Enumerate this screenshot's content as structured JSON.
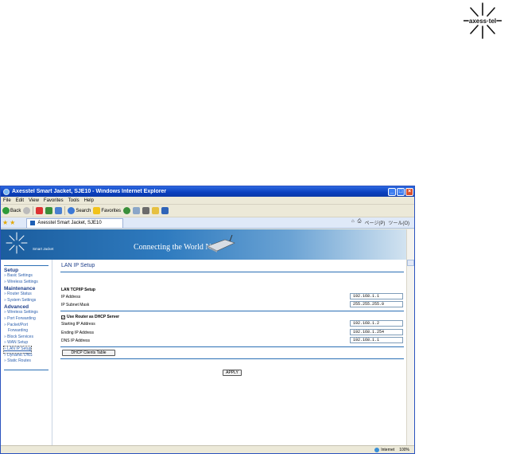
{
  "window": {
    "title": "Axesstel Smart Jacket, SJE10 - Windows Internet Explorer"
  },
  "menu": [
    "File",
    "Edit",
    "View",
    "Favorites",
    "Tools",
    "Help"
  ],
  "toolbar": {
    "back_label": "Back",
    "search_label": "Search",
    "favorites_label": "Favorites"
  },
  "tab": {
    "title": "Axesstel Smart Jacket, SJE10"
  },
  "command_bar": {
    "page_label": "ページ(P)",
    "tools_label": "ツール(O)"
  },
  "banner": {
    "product_label": "Smart Jacket",
    "slogan": "Connecting the World Now"
  },
  "sidebar": {
    "groups": [
      {
        "heading": "Setup",
        "items": [
          "Basic Settings",
          "Wireless Settings"
        ]
      },
      {
        "heading": "Maintenance",
        "items": [
          "Router Status",
          "System Settings"
        ]
      },
      {
        "heading": "Advanced",
        "items": [
          "Wireless Settings",
          "Port Forwarding",
          "Packet/Port",
          "Forwarding",
          "Block Services",
          "WAN Setup",
          "LAN IP Setup",
          "Dynamic DNS",
          "Static Routes"
        ]
      }
    ]
  },
  "main": {
    "title": "LAN IP Setup",
    "tcpip_section": "LAN TCP/IP Setup",
    "ip_address_label": "IP Address",
    "ip_address_value": "192.168.1.1",
    "subnet_label": "IP Subnet Mask",
    "subnet_value": "255.255.255.0",
    "dhcp_checkbox_label": "Use Router as DHCP Server",
    "start_ip_label": "Starting IP Address",
    "start_ip_value": "192.168.1.2",
    "end_ip_label": "Ending IP Address",
    "end_ip_value": "192.168.1.254",
    "dns_label": "DNS IP Address",
    "dns_value": "192.168.1.1",
    "dhcp_table_button": "DHCP Clients Table",
    "apply_button": "APPLY"
  },
  "status": {
    "zone": "Internet",
    "zoom": "100%"
  },
  "colors": {
    "accent": "#2b6fb5",
    "heading": "#1e3f8a",
    "link": "#2b5fad",
    "titlebar": "#0a3fbe"
  }
}
